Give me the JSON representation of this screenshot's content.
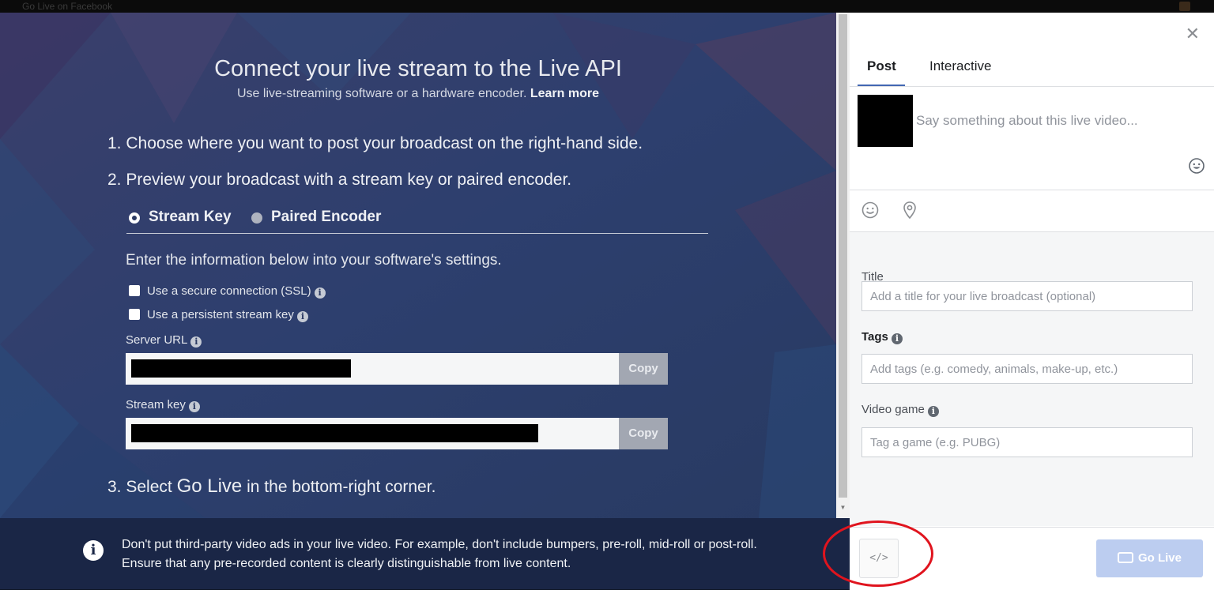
{
  "window": {
    "title": "Go Live on Facebook"
  },
  "main": {
    "heading": "Connect your live stream to the Live API",
    "subheading": "Use live-streaming software or a hardware encoder.",
    "learn_more": "Learn more",
    "step1": "1. Choose where you want to post your broadcast on the right-hand side.",
    "step2": "2. Preview your broadcast with a stream key or paired encoder.",
    "step3_prefix": "3. Select",
    "step3_highlight": "Go Live",
    "step3_suffix": "in the bottom-right corner.",
    "tabs": [
      {
        "label": "Stream Key",
        "selected": true
      },
      {
        "label": "Paired Encoder",
        "selected": false
      }
    ],
    "instruction": "Enter the information below into your software's settings.",
    "checkboxes": [
      {
        "label": "Use a secure connection (SSL)",
        "checked": false
      },
      {
        "label": "Use a persistent stream key",
        "checked": false
      }
    ],
    "server_url_label": "Server URL",
    "stream_key_label": "Stream key",
    "copy_label": "Copy",
    "notice": "Don't put third-party video ads in your live video. For example, don't include bumpers, pre-roll, mid-roll or post-roll. Ensure that any pre-recorded content is clearly distinguishable from live content."
  },
  "panel": {
    "tabs": [
      {
        "label": "Post",
        "active": true
      },
      {
        "label": "Interactive",
        "active": false
      }
    ],
    "post_placeholder": "Say something about this live video...",
    "title_label": "Title",
    "title_placeholder": "Add a title for your live broadcast (optional)",
    "tags_label": "Tags",
    "tags_placeholder": "Add tags (e.g. comedy, animals, make-up, etc.)",
    "game_label": "Video game",
    "game_placeholder": "Tag a game (e.g. PUBG)",
    "embed_label": "</>",
    "go_live_label": "Go Live"
  },
  "icons": {
    "close": "close-icon",
    "emoji": "emoji-icon",
    "feeling": "feeling-icon",
    "location": "location-pin-icon",
    "info": "info-icon",
    "camera": "video-camera-icon"
  },
  "colors": {
    "background": "#2b3a63",
    "notice_bar": "#1a2646",
    "accent": "#4267b2",
    "go_live_disabled": "#bccdf0",
    "annotation": "#e0141e"
  }
}
